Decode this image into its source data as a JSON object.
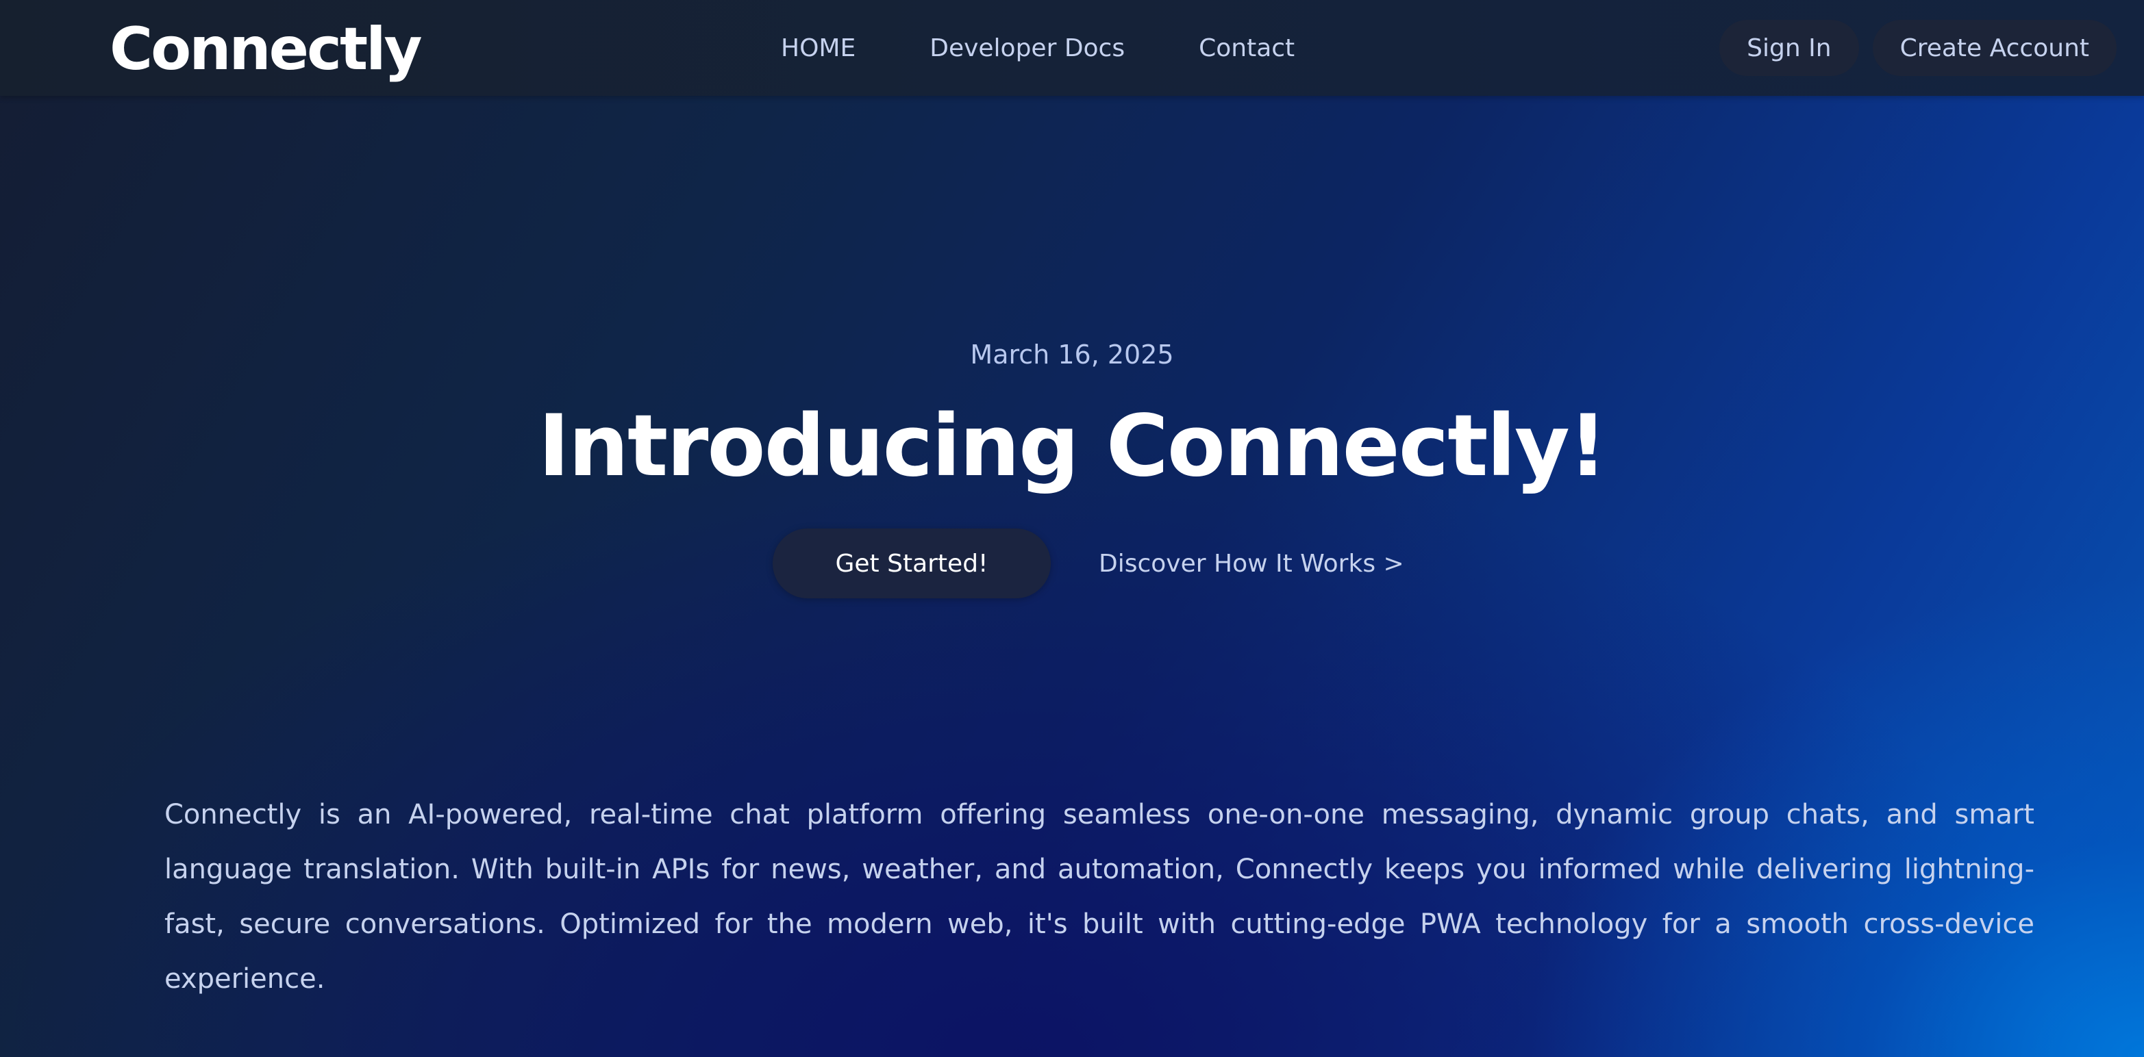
{
  "nav": {
    "logo_text": "Connectly",
    "links": [
      {
        "label": "HOME"
      },
      {
        "label": "Developer Docs"
      },
      {
        "label": "Contact"
      }
    ],
    "sign_in_label": "Sign In",
    "create_account_label": "Create Account"
  },
  "hero": {
    "date": "March 16, 2025",
    "title": "Introducing Connectly!",
    "primary_cta": "Get Started!",
    "secondary_cta": "Discover How It Works >"
  },
  "about": {
    "description": "Connectly is an AI-powered, real-time chat platform offering seamless one-on-one messaging, dynamic group chats, and smart language translation. With built-in APIs for news, weather, and automation, Connectly keeps you informed while delivering lightning-fast, secure conversations. Optimized for the modern web, it's built with cutting-edge PWA technology for a smooth cross-device experience."
  },
  "colors": {
    "nav_background": "#152238",
    "pill_background": "#1c2438",
    "accent_blue": "#0658b8",
    "text_muted": "#c6d2ee"
  }
}
